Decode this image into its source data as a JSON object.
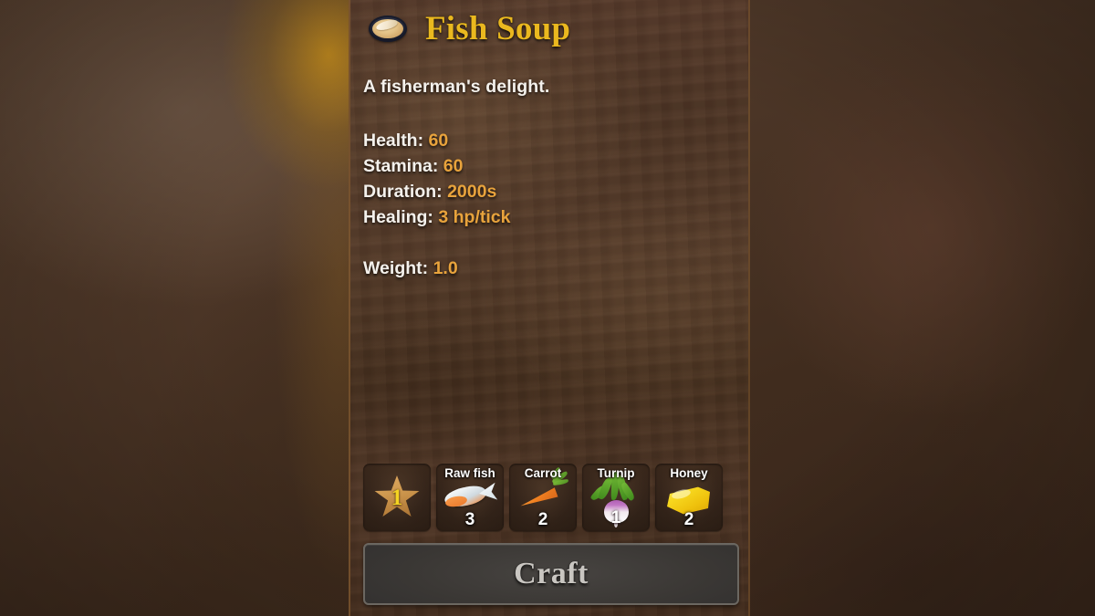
{
  "panel": {
    "item_icon_name": "fish-soup-bowl-icon",
    "title": "Fish Soup",
    "description": "A fisherman's delight."
  },
  "stats": [
    {
      "label": "Health:",
      "value": "60",
      "spaced": false
    },
    {
      "label": "Stamina:",
      "value": "60",
      "spaced": false
    },
    {
      "label": "Duration:",
      "value": "2000s",
      "spaced": false
    },
    {
      "label": "Healing:",
      "value": "3 hp/tick",
      "spaced": false
    },
    {
      "label": "Weight:",
      "value": "1.0",
      "spaced": true
    }
  ],
  "quality_slot": {
    "icon": "star-icon",
    "level": "1"
  },
  "ingredients": [
    {
      "name": "Raw fish",
      "count": "3",
      "icon": "raw-fish-icon"
    },
    {
      "name": "Carrot",
      "count": "2",
      "icon": "carrot-icon"
    },
    {
      "name": "Turnip",
      "count": "1",
      "icon": "turnip-icon"
    },
    {
      "name": "Honey",
      "count": "2",
      "icon": "honey-icon"
    }
  ],
  "craft_button": {
    "label": "Craft"
  },
  "colors": {
    "title_gold": "#eab81f",
    "stat_value_orange": "#e8a33c",
    "body_text": "#f4f1ec",
    "panel_brown": "#4c3425",
    "slot_fill": "#32231a",
    "craft_button_grey": "#3b3835",
    "craft_label_grey": "#c9c6c1",
    "star_bronze": "#d09a50",
    "star_number_yellow": "#f5d422"
  }
}
